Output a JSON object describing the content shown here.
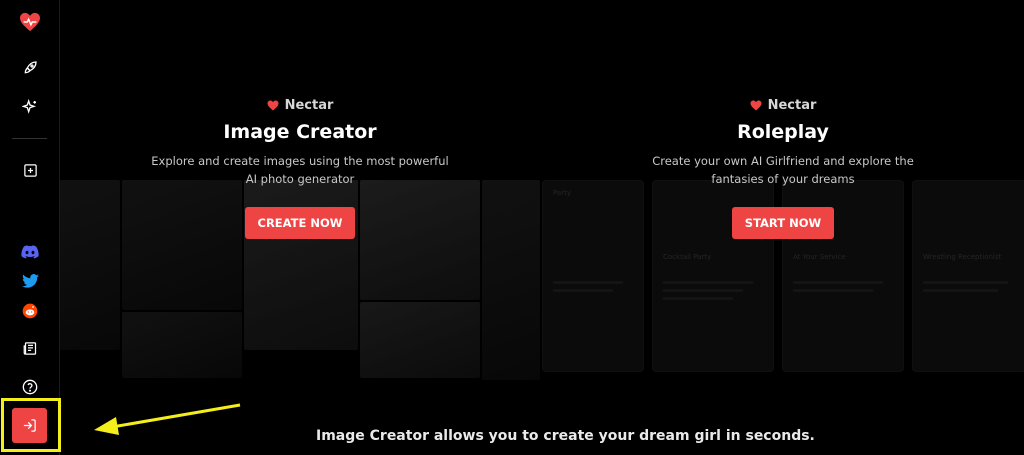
{
  "sidebar": {
    "items": [
      {
        "name": "logo-heart-icon"
      },
      {
        "name": "rocket-icon"
      },
      {
        "name": "sparkles-icon"
      },
      {
        "name": "add-box-icon"
      },
      {
        "name": "discord-icon"
      },
      {
        "name": "twitter-icon"
      },
      {
        "name": "reddit-icon"
      },
      {
        "name": "newspaper-icon"
      },
      {
        "name": "help-circle-icon"
      },
      {
        "name": "login-icon"
      }
    ]
  },
  "sections": [
    {
      "brand": "Nectar",
      "title": "Image Creator",
      "desc_line1": "Explore and create images using the most powerful",
      "desc_line2": "AI photo generator",
      "cta": "CREATE NOW"
    },
    {
      "brand": "Nectar",
      "title": "Roleplay",
      "desc_line1": "Create your own AI Girlfriend and explore the",
      "desc_line2": "fantasies of your dreams",
      "cta": "START NOW"
    }
  ],
  "background_cards": [
    "Party",
    "Cocktail Party",
    "At Your Service",
    "Wrestling Receptionist"
  ],
  "footer_text": "Image Creator allows you to create your dream girl in seconds.",
  "colors": {
    "accent": "#ef4444",
    "highlight": "#f4ee1a",
    "background": "#000000"
  }
}
